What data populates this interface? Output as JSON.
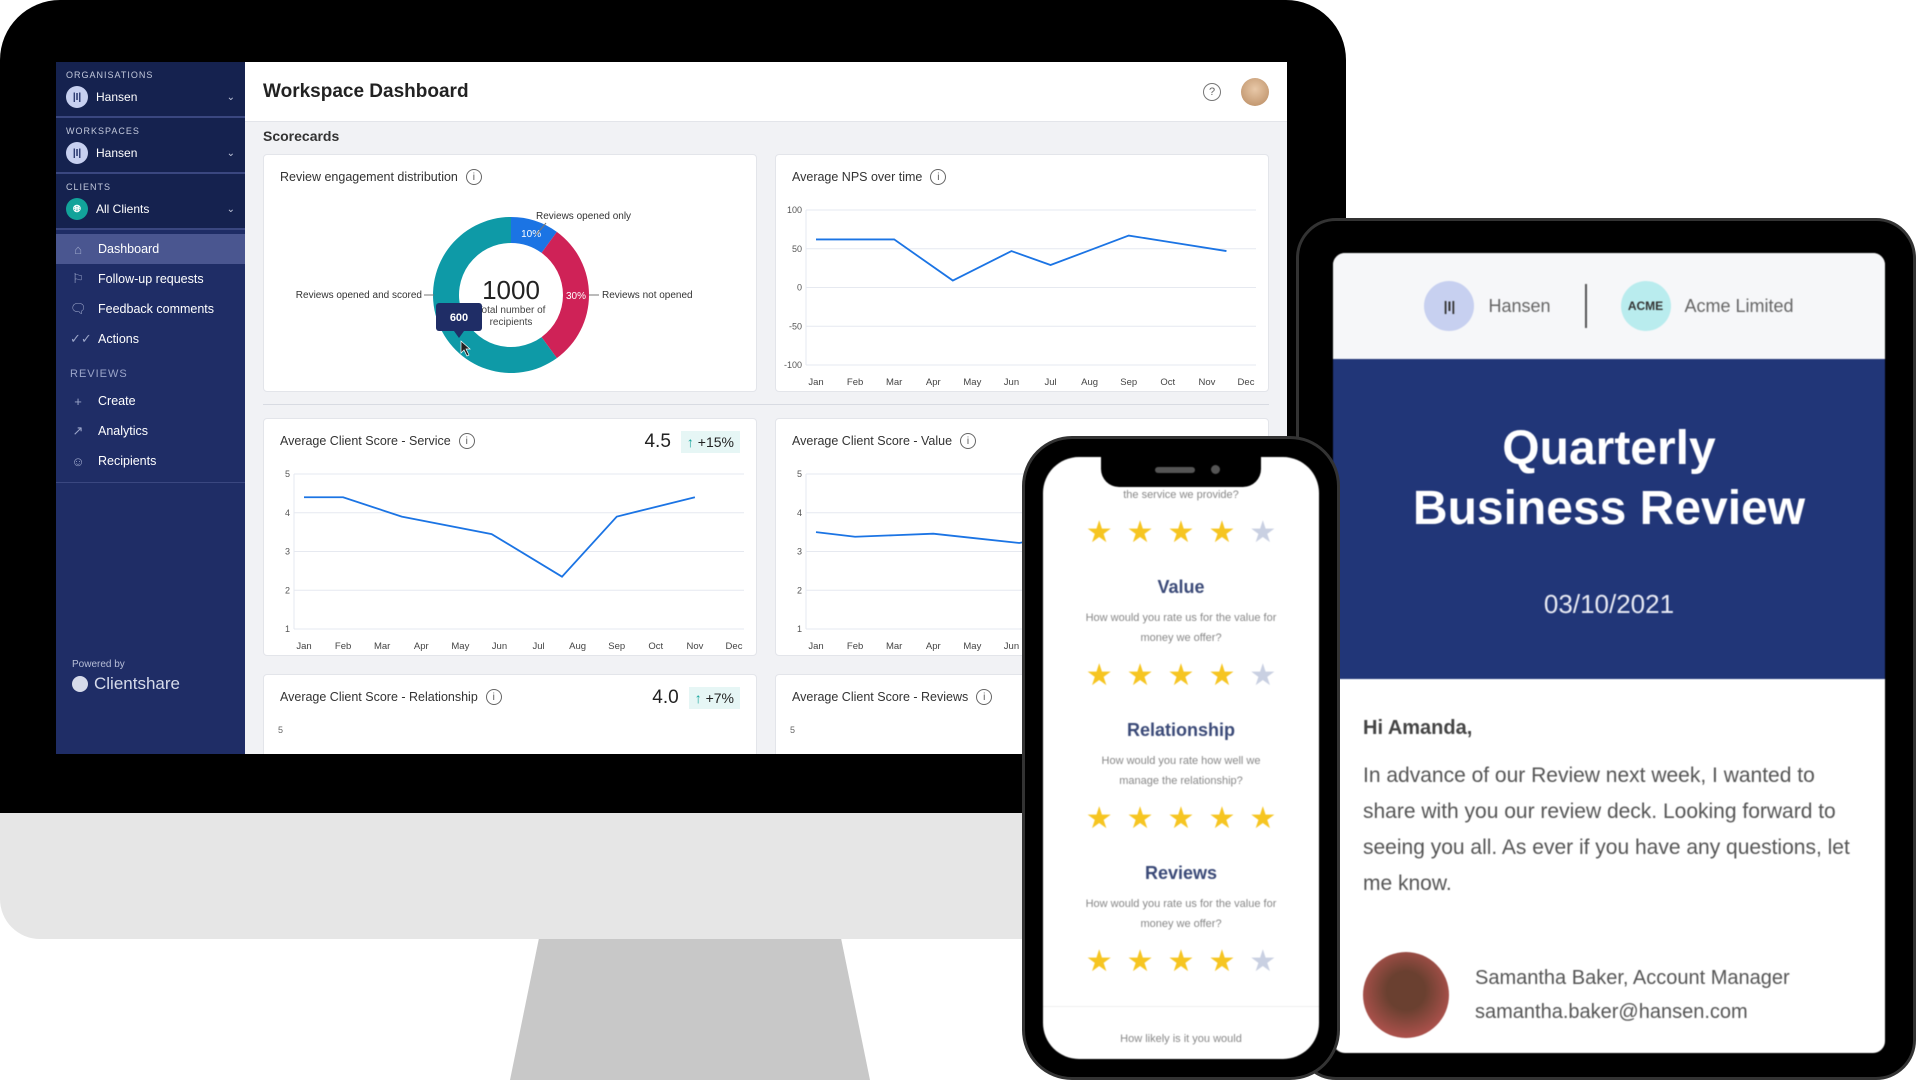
{
  "dashboard": {
    "title": "Workspace Dashboard",
    "section": "Scorecards",
    "sidebar": {
      "organisations": {
        "caption": "ORGANISATIONS",
        "value": "Hansen"
      },
      "workspaces": {
        "caption": "WORKSPACES",
        "value": "Hansen"
      },
      "clients": {
        "caption": "CLIENTS",
        "value": "All Clients"
      },
      "nav": [
        {
          "label": "Dashboard",
          "icon": "home-icon",
          "active": true
        },
        {
          "label": "Follow-up requests",
          "icon": "flag-icon"
        },
        {
          "label": "Feedback comments",
          "icon": "comment-icon"
        },
        {
          "label": "Actions",
          "icon": "double-check-icon"
        }
      ],
      "reviews_heading": "REVIEWS",
      "reviews_nav": [
        {
          "label": "Create",
          "icon": "plus-icon"
        },
        {
          "label": "Analytics",
          "icon": "chart-icon"
        },
        {
          "label": "Recipients",
          "icon": "users-icon"
        }
      ],
      "powered_by": "Powered by",
      "brand": "Clientshare"
    },
    "cards": {
      "engagement": {
        "title": "Review engagement distribution"
      },
      "nps": {
        "title": "Average NPS over time"
      },
      "service": {
        "title": "Average Client Score - Service",
        "score": "4.5",
        "change": "+15%"
      },
      "value": {
        "title": "Average Client Score - Value"
      },
      "relationship": {
        "title": "Average Client Score - Relationship",
        "score": "4.0",
        "change": "+7%"
      },
      "reviews": {
        "title": "Average Client Score - Reviews"
      }
    }
  },
  "chart_data": [
    {
      "type": "pie",
      "title": "Review engagement distribution",
      "center_value": "1000",
      "center_label": "Total number of recipients",
      "slices": [
        {
          "label": "Reviews opened only",
          "percent": 10,
          "display": "10%",
          "color": "#1b74e4"
        },
        {
          "label": "Reviews not opened",
          "percent": 30,
          "display": "30%",
          "color": "#cf2257"
        },
        {
          "label": "Reviews opened and scored",
          "percent": 60,
          "display": "60%",
          "color": "#0e9aa7"
        }
      ],
      "tooltip": "600"
    },
    {
      "type": "line",
      "title": "Average NPS over time",
      "categories": [
        "Jan",
        "Feb",
        "Mar",
        "Apr",
        "May",
        "Jun",
        "Jul",
        "Aug",
        "Sep",
        "Oct",
        "Nov",
        "Dec"
      ],
      "yticks": [
        "100",
        "50",
        "0",
        "-50",
        "-100"
      ],
      "ylim": [
        -100,
        100
      ],
      "points": [
        [
          0,
          62
        ],
        [
          1,
          62
        ],
        [
          2,
          62
        ],
        [
          3.5,
          9
        ],
        [
          5,
          47
        ],
        [
          6,
          29
        ],
        [
          7,
          48
        ],
        [
          8,
          67
        ],
        [
          9,
          59
        ],
        [
          10.5,
          47
        ]
      ]
    },
    {
      "type": "line",
      "title": "Average Client Score - Service",
      "categories": [
        "Jan",
        "Feb",
        "Mar",
        "Apr",
        "May",
        "Jun",
        "Jul",
        "Aug",
        "Sep",
        "Oct",
        "Nov",
        "Dec"
      ],
      "yticks": [
        "5",
        "4",
        "3",
        "2",
        "1"
      ],
      "ylim": [
        1,
        5
      ],
      "points": [
        [
          0,
          4.4
        ],
        [
          1,
          4.4
        ],
        [
          2.5,
          3.9
        ],
        [
          4.8,
          3.45
        ],
        [
          6.6,
          2.35
        ],
        [
          8,
          3.9
        ],
        [
          10,
          4.4
        ]
      ]
    },
    {
      "type": "line",
      "title": "Average Client Score - Value",
      "categories": [
        "Jan",
        "Feb",
        "Mar",
        "Apr",
        "May",
        "Jun"
      ],
      "yticks": [
        "5",
        "4",
        "3",
        "2",
        "1"
      ],
      "ylim": [
        1,
        5
      ],
      "points": [
        [
          0,
          3.5
        ],
        [
          1,
          3.38
        ],
        [
          2,
          3.42
        ],
        [
          3,
          3.46
        ],
        [
          4,
          3.35
        ],
        [
          5.2,
          3.22
        ],
        [
          5.6,
          3.3
        ]
      ]
    }
  ],
  "phone": {
    "top_question": "the service we provide?",
    "sections": [
      {
        "title": "",
        "question": "",
        "rating": 4
      },
      {
        "title": "Value",
        "question": "How would you rate us for the value for money we offer?",
        "rating": 4
      },
      {
        "title": "Relationship",
        "question": "How would you rate how well we manage the relationship?",
        "rating": 5
      },
      {
        "title": "Reviews",
        "question": "How would you rate us for the value for money we offer?",
        "rating": 4
      }
    ],
    "bottom_question": "How likely is it you would"
  },
  "tablet": {
    "org1": "Hansen",
    "org2": "Acme Limited",
    "org2_logo": "ACME",
    "title_line1": "Quarterly",
    "title_line2": "Business Review",
    "date": "03/10/2021",
    "greeting": "Hi Amanda,",
    "body": "In advance of our Review next week, I wanted to share with you our review deck. Looking forward to seeing you all. As ever if you have any questions, let me know.",
    "signature_name": "Samantha Baker, Account Manager",
    "signature_email": "samantha.baker@hansen.com"
  }
}
